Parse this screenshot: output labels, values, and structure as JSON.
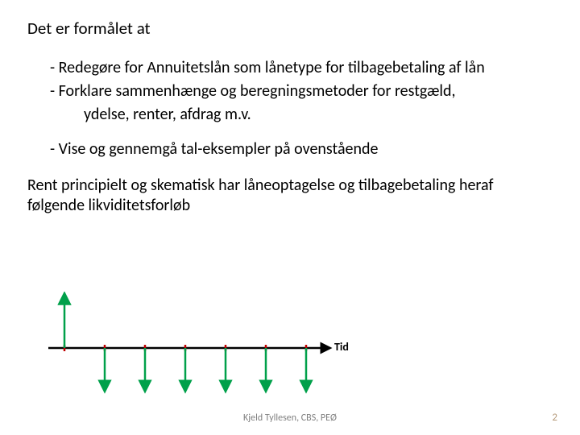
{
  "heading": "Det er formålet at",
  "bullet1": "- Redegøre for Annuitetslån som lånetype for tilbagebetaling af lån",
  "bullet2a": "- Forklare sammenhænge og beregningsmetoder for restgæld,",
  "bullet2b": "ydelse, renter, afdrag m.v.",
  "bullet3": "- Vise og gennemgå tal-eksempler på ovenstående",
  "para": "Rent principielt og skematisk har låneoptagelse og tilbagebetaling heraf følgende likviditetsforløb",
  "axis_label": "Tid",
  "footer_center": "Kjeld Tyllesen, CBS, PEØ",
  "footer_right": "2",
  "chart_data": {
    "type": "diagram",
    "description": "Cash-flow timeline: one large upward arrow at t0 (loan receipt) followed by six equal downward arrows (repayments) along a horizontal time axis labeled 'Tid'.",
    "up_arrow_index": 0,
    "down_arrow_count": 6,
    "tick_count": 7
  }
}
